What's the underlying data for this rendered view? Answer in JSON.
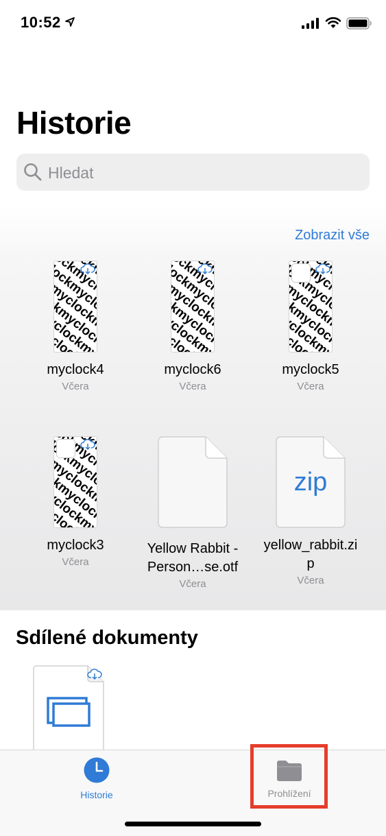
{
  "status": {
    "time": "10:52"
  },
  "header": {
    "title": "Historie"
  },
  "search": {
    "placeholder": "Hledat",
    "value": ""
  },
  "recents": {
    "show_all_label": "Zobrazit vše",
    "items": [
      {
        "name": "myclock4",
        "date": "Včera",
        "type": "image",
        "icon": "cloud-download-icon"
      },
      {
        "name": "myclock6",
        "date": "Včera",
        "type": "image",
        "icon": "cloud-download-icon"
      },
      {
        "name": "myclock5",
        "date": "Včera",
        "type": "image",
        "icon": "cloud-download-icon"
      },
      {
        "name": "myclock3",
        "date": "Včera",
        "type": "image",
        "icon": "cloud-download-icon"
      },
      {
        "name_line1": "Yellow Rabbit -",
        "name_line2": "Person…se.otf",
        "date": "Včera",
        "type": "font",
        "icon": "document-icon"
      },
      {
        "name_line1": "yellow_rabbit.zi",
        "name_line2": "p",
        "date": "Včera",
        "type": "zip",
        "icon_label": "zip"
      }
    ],
    "pattern_text": "myclock"
  },
  "shared": {
    "title": "Sdílené dokumenty"
  },
  "tabs": [
    {
      "label": "Historie",
      "icon": "clock-icon",
      "active": true
    },
    {
      "label": "Prohlížení",
      "icon": "folder-icon",
      "active": false
    }
  ],
  "colors": {
    "accent": "#2f7bd6",
    "highlight": "#e53d2b"
  }
}
